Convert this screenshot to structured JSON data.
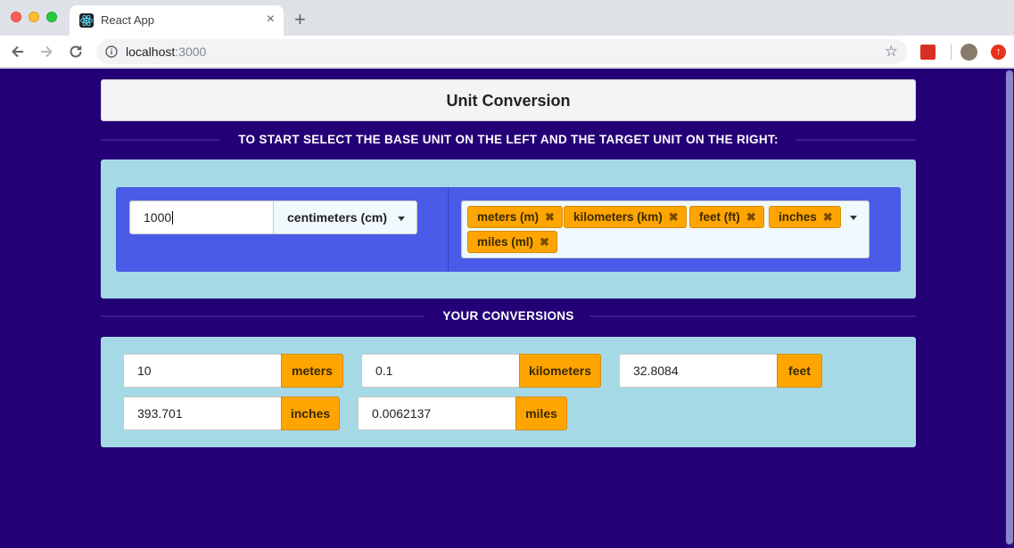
{
  "browser": {
    "tab_title": "React App",
    "tab_close": "×",
    "new_tab": "+",
    "url_host": "localhost",
    "url_port": ":3000",
    "bookmark_star": "☆",
    "update_icon": "↑"
  },
  "header": {
    "title": "Unit Conversion"
  },
  "instructions": "TO START SELECT THE BASE UNIT ON THE LEFT AND THE TARGET UNIT ON THE RIGHT:",
  "base": {
    "value": "1000",
    "unit": "centimeters (cm)"
  },
  "targets": [
    {
      "label": "meters (m)",
      "remove": "✖"
    },
    {
      "label": "kilometers (km)",
      "remove": "✖"
    },
    {
      "label": "feet (ft)",
      "remove": "✖"
    },
    {
      "label": "inches",
      "remove": "✖"
    },
    {
      "label": "miles (ml)",
      "remove": "✖"
    }
  ],
  "conversions_heading": "YOUR CONVERSIONS",
  "conversions": [
    {
      "value": "10",
      "unit": "meters"
    },
    {
      "value": "0.1",
      "unit": "kilometers"
    },
    {
      "value": "32.8084",
      "unit": "feet"
    },
    {
      "value": "393.701",
      "unit": "inches"
    },
    {
      "value": "0.0062137",
      "unit": "miles"
    }
  ],
  "colors": {
    "page_bg": "#230076",
    "panel_bg": "#a6d9e6",
    "segment_blue": "#4a5be7",
    "chip_orange": "#ffa502"
  }
}
